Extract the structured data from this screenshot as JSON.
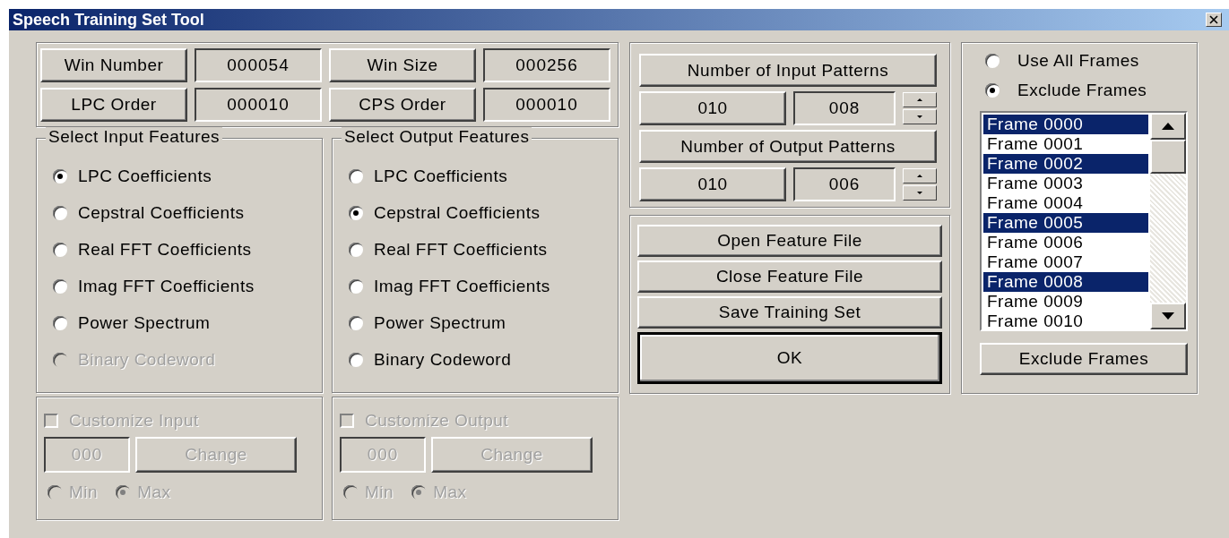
{
  "window": {
    "title": "Speech Training Set Tool"
  },
  "parameters": [
    {
      "label": "Win Number",
      "value": "000054"
    },
    {
      "label": "Win Size",
      "value": "000256"
    },
    {
      "label": "LPC Order",
      "value": "000010"
    },
    {
      "label": "CPS Order",
      "value": "000010"
    }
  ],
  "feature_groups": [
    {
      "title": "Select Input Features",
      "options": [
        {
          "label": "LPC Coefficients",
          "selected": true,
          "disabled": false
        },
        {
          "label": "Cepstral Coefficients",
          "selected": false,
          "disabled": false
        },
        {
          "label": "Real FFT Coefficients",
          "selected": false,
          "disabled": false
        },
        {
          "label": "Imag FFT Coefficients",
          "selected": false,
          "disabled": false
        },
        {
          "label": "Power Spectrum",
          "selected": false,
          "disabled": false
        },
        {
          "label": "Binary Codeword",
          "selected": false,
          "disabled": true
        }
      ],
      "customize": {
        "label": "Customize Input",
        "checked": false,
        "disabled": true,
        "value": "000",
        "button": "Change",
        "choices": [
          {
            "label": "Min",
            "selected": false
          },
          {
            "label": "Max",
            "selected": true
          }
        ]
      }
    },
    {
      "title": "Select Output Features",
      "options": [
        {
          "label": "LPC Coefficients",
          "selected": false,
          "disabled": false
        },
        {
          "label": "Cepstral Coefficients",
          "selected": true,
          "disabled": false
        },
        {
          "label": "Real FFT Coefficients",
          "selected": false,
          "disabled": false
        },
        {
          "label": "Imag FFT Coefficients",
          "selected": false,
          "disabled": false
        },
        {
          "label": "Power Spectrum",
          "selected": false,
          "disabled": false
        },
        {
          "label": "Binary Codeword",
          "selected": false,
          "disabled": false
        }
      ],
      "customize": {
        "label": "Customize Output",
        "checked": false,
        "disabled": true,
        "value": "000",
        "button": "Change",
        "choices": [
          {
            "label": "Min",
            "selected": false
          },
          {
            "label": "Max",
            "selected": true
          }
        ]
      }
    }
  ],
  "patterns": [
    {
      "button": "Number of Input Patterns",
      "total": "010",
      "value": "008"
    },
    {
      "button": "Number of Output Patterns",
      "total": "010",
      "value": "006"
    }
  ],
  "actions": [
    {
      "label": "Open Feature File",
      "default": false
    },
    {
      "label": "Close Feature File",
      "default": false
    },
    {
      "label": "Save Training Set",
      "default": false
    },
    {
      "label": "OK",
      "default": true
    }
  ],
  "frames": {
    "modes": [
      {
        "label": "Use All Frames",
        "selected": false
      },
      {
        "label": "Exclude Frames",
        "selected": true
      }
    ],
    "list": [
      {
        "label": "Frame 0000",
        "selected": true
      },
      {
        "label": "Frame 0001",
        "selected": false
      },
      {
        "label": "Frame 0002",
        "selected": true
      },
      {
        "label": "Frame 0003",
        "selected": false
      },
      {
        "label": "Frame 0004",
        "selected": false
      },
      {
        "label": "Frame 0005",
        "selected": true
      },
      {
        "label": "Frame 0006",
        "selected": false
      },
      {
        "label": "Frame 0007",
        "selected": false
      },
      {
        "label": "Frame 0008",
        "selected": true
      },
      {
        "label": "Frame 0009",
        "selected": false
      },
      {
        "label": "Frame 0010",
        "selected": false
      }
    ],
    "button": "Exclude Frames"
  }
}
